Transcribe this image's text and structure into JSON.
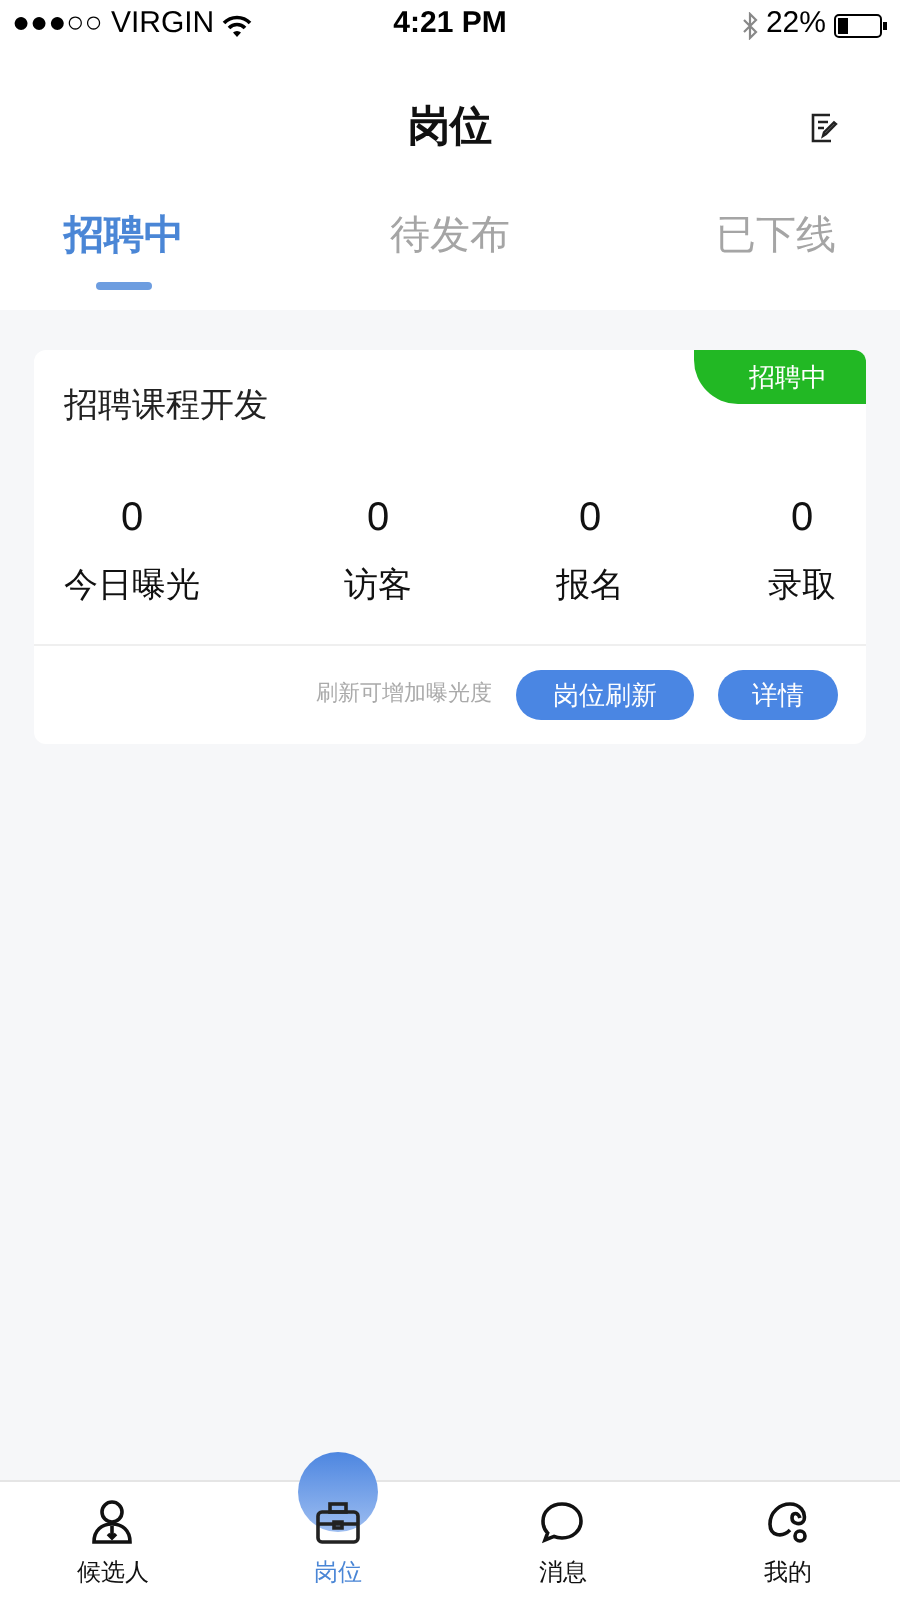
{
  "status_bar": {
    "carrier": "●●●○○ VIRGIN",
    "time": "4:21 PM",
    "battery": "22%"
  },
  "header": {
    "title": "岗位"
  },
  "tabs": [
    {
      "label": "招聘中",
      "selected": true
    },
    {
      "label": "待发布",
      "selected": false
    },
    {
      "label": "已下线",
      "selected": false
    }
  ],
  "jobs": [
    {
      "title": "招聘课程开发",
      "badge": "招聘中",
      "stats": [
        {
          "value": "0",
          "label": "今日曝光"
        },
        {
          "value": "0",
          "label": "访客"
        },
        {
          "value": "0",
          "label": "报名"
        },
        {
          "value": "0",
          "label": "录取"
        }
      ],
      "hint": "刷新可增加曝光度",
      "buttons": [
        "岗位刷新",
        "详情"
      ]
    }
  ],
  "bottom_nav": [
    {
      "label": "候选人",
      "selected": false
    },
    {
      "label": "岗位",
      "selected": true
    },
    {
      "label": "消息",
      "selected": false
    },
    {
      "label": "我的",
      "selected": false
    }
  ]
}
